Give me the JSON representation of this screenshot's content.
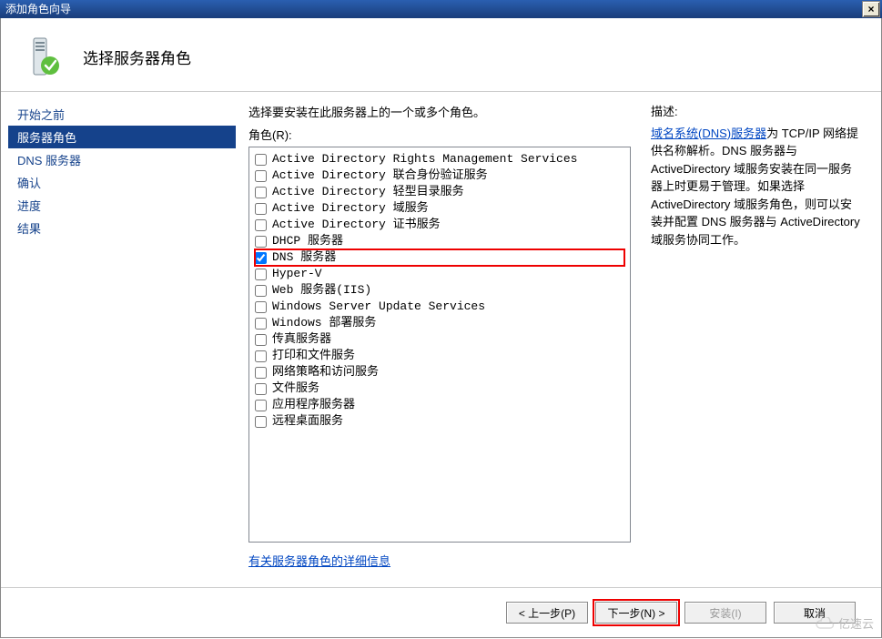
{
  "window": {
    "title": "添加角色向导",
    "close_label": "×"
  },
  "header": {
    "title": "选择服务器角色"
  },
  "sidebar": {
    "items": [
      {
        "label": "开始之前",
        "selected": false
      },
      {
        "label": "服务器角色",
        "selected": true
      },
      {
        "label": "DNS 服务器",
        "selected": false
      },
      {
        "label": "确认",
        "selected": false
      },
      {
        "label": "进度",
        "selected": false
      },
      {
        "label": "结果",
        "selected": false
      }
    ]
  },
  "main": {
    "instruction": "选择要安装在此服务器上的一个或多个角色。",
    "roles_label": "角色(R):",
    "more_link": "有关服务器角色的详细信息",
    "roles": [
      {
        "label": "Active Directory Rights Management Services",
        "checked": false,
        "highlight": false
      },
      {
        "label": "Active Directory 联合身份验证服务",
        "checked": false,
        "highlight": false
      },
      {
        "label": "Active Directory 轻型目录服务",
        "checked": false,
        "highlight": false
      },
      {
        "label": "Active Directory 域服务",
        "checked": false,
        "highlight": false
      },
      {
        "label": "Active Directory 证书服务",
        "checked": false,
        "highlight": false
      },
      {
        "label": "DHCP 服务器",
        "checked": false,
        "highlight": false
      },
      {
        "label": "DNS 服务器",
        "checked": true,
        "highlight": true
      },
      {
        "label": "Hyper-V",
        "checked": false,
        "highlight": false
      },
      {
        "label": "Web 服务器(IIS)",
        "checked": false,
        "highlight": false
      },
      {
        "label": "Windows Server Update Services",
        "checked": false,
        "highlight": false
      },
      {
        "label": "Windows 部署服务",
        "checked": false,
        "highlight": false
      },
      {
        "label": "传真服务器",
        "checked": false,
        "highlight": false
      },
      {
        "label": "打印和文件服务",
        "checked": false,
        "highlight": false
      },
      {
        "label": "网络策略和访问服务",
        "checked": false,
        "highlight": false
      },
      {
        "label": "文件服务",
        "checked": false,
        "highlight": false
      },
      {
        "label": "应用程序服务器",
        "checked": false,
        "highlight": false
      },
      {
        "label": "远程桌面服务",
        "checked": false,
        "highlight": false
      }
    ]
  },
  "description": {
    "title": "描述:",
    "link_text": "域名系统(DNS)服务器",
    "body": "为 TCP/IP 网络提供名称解析。DNS 服务器与 ActiveDirectory 域服务安装在同一服务器上时更易于管理。如果选择 ActiveDirectory 域服务角色，则可以安装并配置 DNS 服务器与 ActiveDirectory 域服务协同工作。"
  },
  "footer": {
    "back": "< 上一步(P)",
    "next": "下一步(N) >",
    "install": "安装(I)",
    "cancel": "取消",
    "next_highlight": true,
    "install_disabled": true
  },
  "watermark": "亿速云"
}
